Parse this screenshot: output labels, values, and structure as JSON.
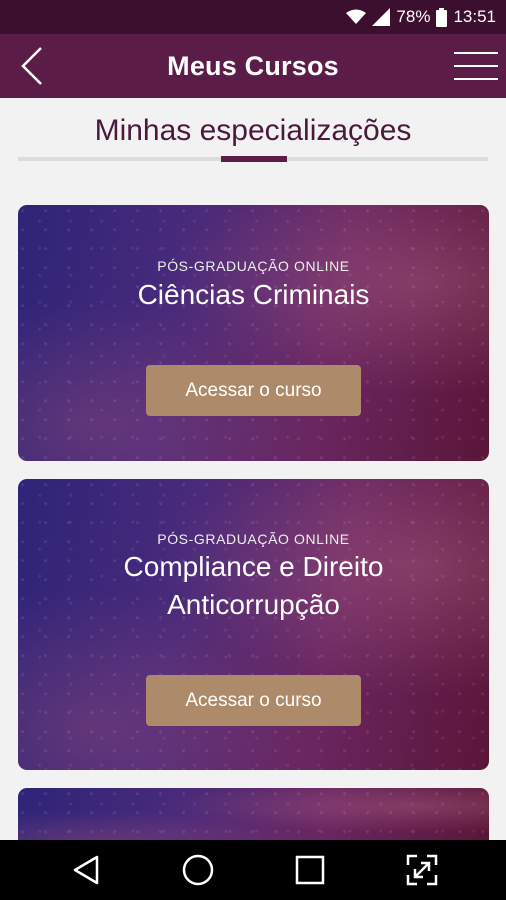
{
  "status_bar": {
    "battery": "78%",
    "time": "13:51",
    "icons": [
      "wifi-icon",
      "signal-icon",
      "battery-icon"
    ]
  },
  "app_bar": {
    "title": "Meus Cursos",
    "back_icon": "chevron-left-icon",
    "menu_icon": "menu-icon"
  },
  "section": {
    "title": "Minhas especializações"
  },
  "courses": [
    {
      "kicker": "PÓS-GRADUAÇÃO ONLINE",
      "title_lines": [
        "Ciências Criminais"
      ],
      "button_label": "Acessar o curso"
    },
    {
      "kicker": "PÓS-GRADUAÇÃO ONLINE",
      "title_lines": [
        "Compliance e Direito",
        "Anticorrupção"
      ],
      "button_label": "Acessar o curso"
    }
  ],
  "nav_bar": {
    "icons": [
      "back-triangle-icon",
      "home-circle-icon",
      "recents-square-icon",
      "fullscreen-icon"
    ]
  },
  "colors": {
    "status_bar": "#3c0f2e",
    "app_bar": "#5b1d48",
    "section_title": "#4a1a3c",
    "button": "#ad8a69"
  }
}
